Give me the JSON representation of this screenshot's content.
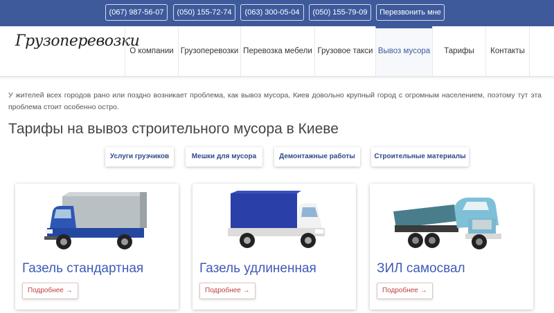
{
  "topbar": {
    "phones": [
      "(067) 987-56-07",
      "(050) 155-72-74",
      "(063) 300-05-04",
      "(050) 155-79-09"
    ],
    "callback_label": "Перезвонить мне"
  },
  "nav": {
    "logo": "Грузоперевозки",
    "items": [
      "О компании",
      "Грузоперевозки",
      "Перевозка мебели",
      "Грузовое такси",
      "Вывоз мусора",
      "Тарифы",
      "Контакты"
    ],
    "active": "Вывоз мусора"
  },
  "main": {
    "intro": "У жителей всех городов рано или поздно возникает проблема, как вывоз мусора, Киев довольно крупный город с огромным населением, поэтому тут эта проблема стоит особенно остро.",
    "title": "Тарифы на вывоз строительного мусора в Киеве",
    "pills": [
      "Услуги грузчиков",
      "Мешки для мусора",
      "Демонтажные работы",
      "Строительные материалы"
    ],
    "cards": [
      {
        "title": "Газель стандартная",
        "button": "Подробнее →",
        "icon": "gazelle-truck-image"
      },
      {
        "title": "Газель удлиненная",
        "button": "Подробнее →",
        "icon": "long-gazelle-truck-image"
      },
      {
        "title": "ЗИЛ самосвал",
        "button": "Подробнее →",
        "icon": "zil-dump-truck-image"
      }
    ]
  },
  "colors": {
    "topbar": "#3e5a9b",
    "link": "#3e5ab8",
    "more_button": "#c04040"
  }
}
